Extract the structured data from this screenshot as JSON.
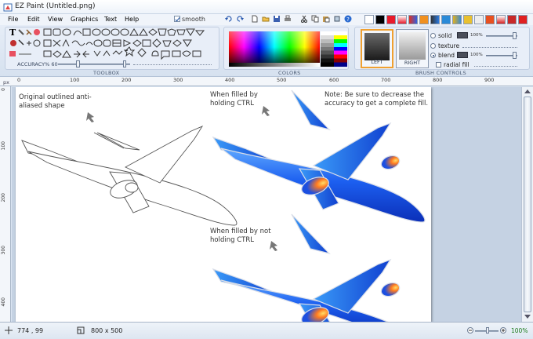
{
  "window": {
    "title": "EZ Paint (Untitled.png)"
  },
  "menu": {
    "items": [
      "File",
      "Edit",
      "View",
      "Graphics",
      "Text",
      "Help"
    ],
    "smooth_label": "smooth",
    "smooth_checked": true
  },
  "toolbox": {
    "label": "TOOLBOX",
    "accuracy_label": "ACCURACY%",
    "accuracy_value": "60"
  },
  "colors": {
    "label": "COLORS"
  },
  "brush_controls": {
    "label": "BRUSH CONTROLS",
    "left_label": "LEFT",
    "right_label": "RIGHT",
    "options": [
      {
        "label": "solid",
        "selected": false,
        "value": "100%"
      },
      {
        "label": "texture",
        "selected": false
      },
      {
        "label": "blend",
        "selected": true,
        "value": "100%"
      }
    ],
    "radial_fill_label": "radial fill"
  },
  "ruler": {
    "unit": "px",
    "h_labels": [
      "0",
      "100",
      "200",
      "300",
      "400",
      "500",
      "600",
      "700",
      "800",
      "900"
    ],
    "v_labels": [
      "0",
      "100",
      "200",
      "300",
      "400"
    ]
  },
  "canvas": {
    "annotations": {
      "original": "Original outlined anti-aliased shape",
      "ctrl": "When filled by holding CTRL",
      "note": "Note: Be sure to decrease the accuracy to get a complete fill.",
      "no_ctrl": "When filled by not holding CTRL"
    }
  },
  "status": {
    "cursor": "774 ,  99",
    "size": "800  x  500",
    "zoom": "100%"
  },
  "colors_palette": {
    "accent": "#f0a030",
    "fill_blue": "#1f5fe8"
  }
}
